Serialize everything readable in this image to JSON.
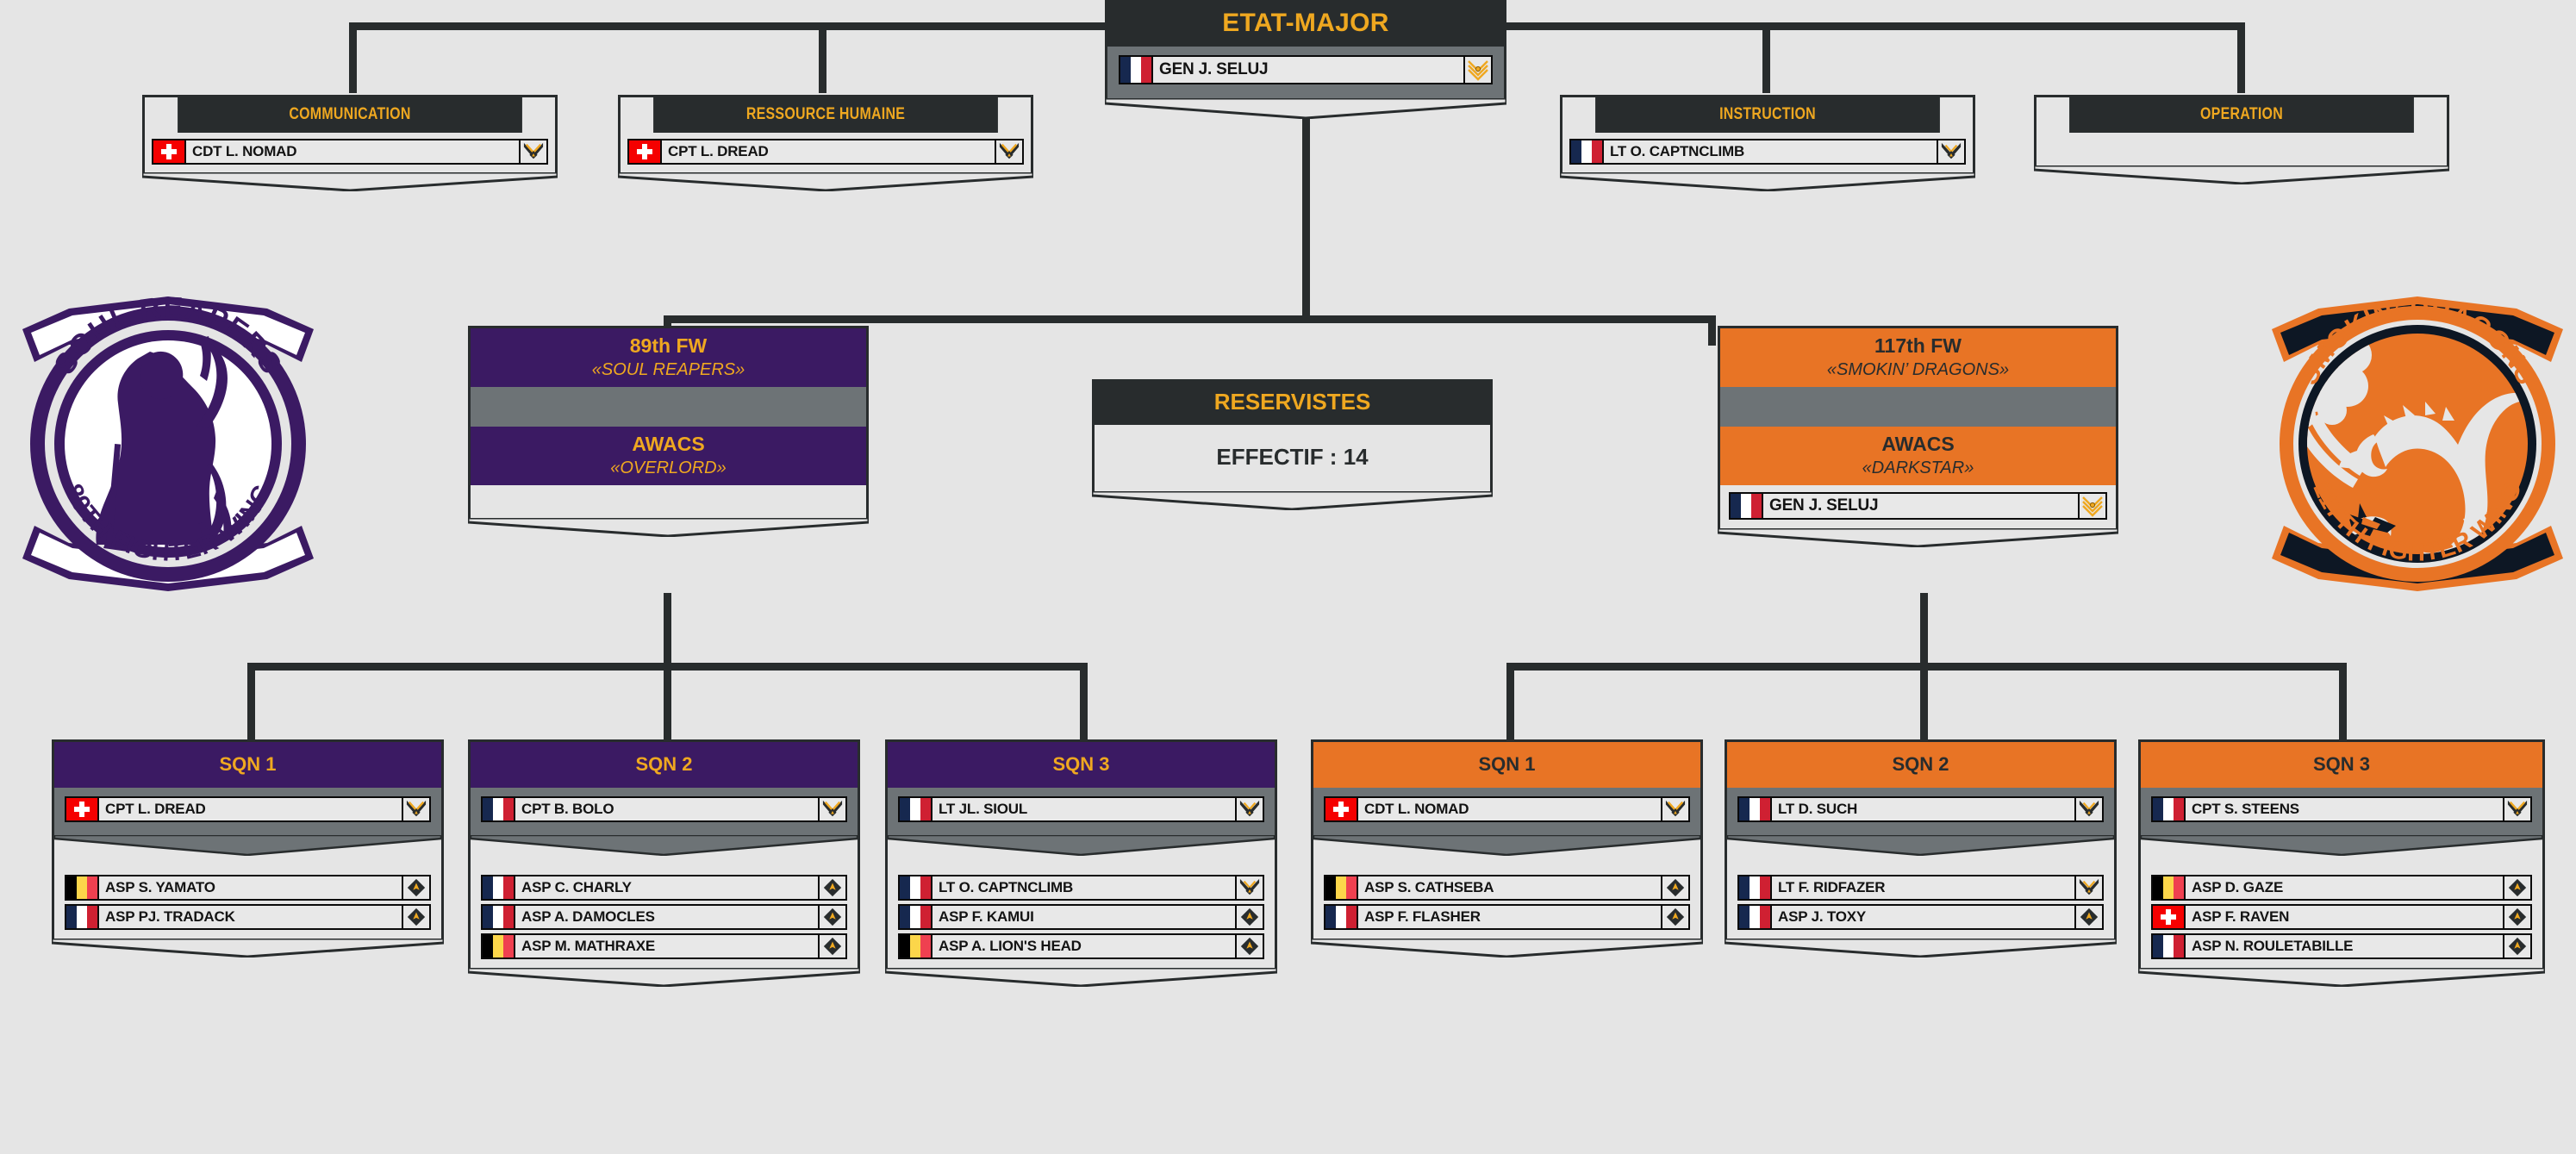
{
  "palette": {
    "background": "#e5e5e5",
    "dark": "#282c2d",
    "gold": "#efa820",
    "purple": "#3b1a63",
    "orange": "#e87425",
    "grey_band": "#6d7376",
    "flag_fr_blue": "#16284f",
    "flag_fr_red": "#cf2032",
    "flag_be_yellow": "#fcd64a",
    "flag_be_red": "#ef4050",
    "flag_ch_red": "#f50000"
  },
  "etat_major": {
    "title": "ETAT-MAJOR",
    "members": [
      {
        "name": "GEN J. SELUJ",
        "flag": "fr",
        "rank": "gen"
      }
    ]
  },
  "departments": [
    {
      "title": "COMMUNICATION",
      "members": [
        {
          "name": "CDT L. NOMAD",
          "flag": "ch",
          "rank": "officer"
        }
      ]
    },
    {
      "title": "RESSOURCE HUMAINE",
      "members": [
        {
          "name": "CPT L. DREAD",
          "flag": "ch",
          "rank": "officer"
        }
      ]
    },
    {
      "title": "INSTRUCTION",
      "members": [
        {
          "name": "LT O. CAPTNCLIMB",
          "flag": "fr",
          "rank": "lt"
        }
      ]
    },
    {
      "title": "OPERATION",
      "members": []
    }
  ],
  "reservistes": {
    "title": "RESERVISTES",
    "effectif_label": "EFFECTIF :",
    "effectif_value": "14",
    "effectif_line": "EFFECTIF :  14"
  },
  "wings": [
    {
      "id": "89th",
      "title": "89th FW",
      "nickname": "«SOUL REAPERS»",
      "awacs_title": "AWACS",
      "awacs_nickname": "«OVERLORD»",
      "theme": "purple",
      "members": [],
      "patch": {
        "top_text": "SOUL REAPERS",
        "bottom_text": "89TH FIGHTER WING",
        "emblem": "grim-reaper"
      },
      "squadrons": [
        {
          "title": "SQN 1",
          "commander": {
            "name": "CPT L. DREAD",
            "flag": "ch",
            "rank": "officer"
          },
          "members": [
            {
              "name": "ASP S. YAMATO",
              "flag": "be",
              "rank": "asp"
            },
            {
              "name": "ASP PJ. TRADACK",
              "flag": "fr",
              "rank": "asp"
            }
          ]
        },
        {
          "title": "SQN 2",
          "commander": {
            "name": "CPT B. BOLO",
            "flag": "fr",
            "rank": "officer"
          },
          "members": [
            {
              "name": "ASP C. CHARLY",
              "flag": "fr",
              "rank": "asp"
            },
            {
              "name": "ASP A. DAMOCLES",
              "flag": "fr",
              "rank": "asp"
            },
            {
              "name": "ASP M. MATHRAXE",
              "flag": "be",
              "rank": "asp"
            }
          ]
        },
        {
          "title": "SQN 3",
          "commander": {
            "name": "LT JL. SIOUL",
            "flag": "fr",
            "rank": "lt"
          },
          "members": [
            {
              "name": "LT O. CAPTNCLIMB",
              "flag": "fr",
              "rank": "lt"
            },
            {
              "name": "ASP F. KAMUI",
              "flag": "fr",
              "rank": "asp"
            },
            {
              "name": "ASP A. LION'S HEAD",
              "flag": "be",
              "rank": "asp"
            }
          ]
        }
      ]
    },
    {
      "id": "117th",
      "title": "117th FW",
      "nickname": "«SMOKIN’ DRAGONS»",
      "awacs_title": "AWACS",
      "awacs_nickname": "«DARKSTAR»",
      "theme": "orange",
      "members": [
        {
          "name": "GEN J. SELUJ",
          "flag": "fr",
          "rank": "gen"
        }
      ],
      "patch": {
        "top_text": "SMOKIN’ DRAGONS",
        "bottom_text": "117TH FIGHTER WING",
        "emblem": "dragon"
      },
      "squadrons": [
        {
          "title": "SQN 1",
          "commander": {
            "name": "CDT L. NOMAD",
            "flag": "ch",
            "rank": "officer"
          },
          "members": [
            {
              "name": "ASP S. CATHSEBA",
              "flag": "be",
              "rank": "asp"
            },
            {
              "name": "ASP F. FLASHER",
              "flag": "fr",
              "rank": "asp"
            }
          ]
        },
        {
          "title": "SQN 2",
          "commander": {
            "name": "LT D. SUCH",
            "flag": "fr",
            "rank": "lt"
          },
          "members": [
            {
              "name": "LT F. RIDFAZER",
              "flag": "fr",
              "rank": "lt"
            },
            {
              "name": "ASP J. TOXY",
              "flag": "fr",
              "rank": "asp"
            }
          ]
        },
        {
          "title": "SQN 3",
          "commander": {
            "name": "CPT S. STEENS",
            "flag": "fr",
            "rank": "officer"
          },
          "members": [
            {
              "name": "ASP D. GAZE",
              "flag": "be",
              "rank": "asp"
            },
            {
              "name": "ASP F. RAVEN",
              "flag": "ch",
              "rank": "asp"
            },
            {
              "name": "ASP N. ROULETABILLE",
              "flag": "fr",
              "rank": "asp"
            }
          ]
        }
      ]
    }
  ]
}
